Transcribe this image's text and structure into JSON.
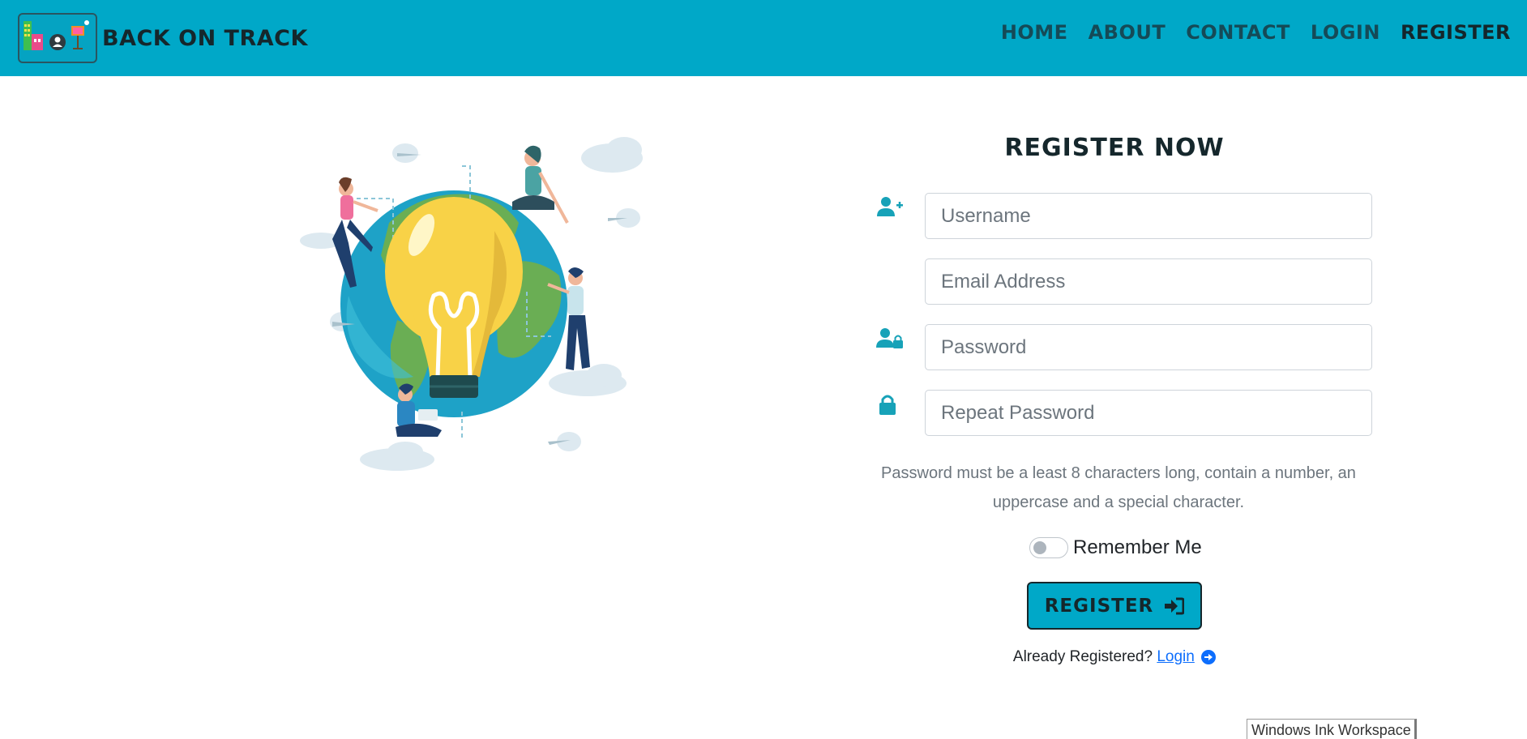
{
  "brand": {
    "name": "Back On Track"
  },
  "nav": {
    "items": [
      {
        "label": "Home"
      },
      {
        "label": "About"
      },
      {
        "label": "Contact"
      },
      {
        "label": "Login"
      },
      {
        "label": "Register"
      }
    ],
    "active": "Register"
  },
  "form": {
    "title": "Register Now",
    "fields": {
      "username": {
        "placeholder": "Username",
        "icon": "user-plus-icon"
      },
      "email": {
        "placeholder": "Email Address"
      },
      "password": {
        "placeholder": "Password",
        "icon": "user-lock-icon"
      },
      "repeat_password": {
        "placeholder": "Repeat Password",
        "icon": "lock-icon"
      }
    },
    "hint": "Password must be a least 8 characters long, contain a number, an uppercase and a special character.",
    "remember_label": "Remember Me",
    "remember_checked": false,
    "submit_label": "Register",
    "already_text": "Already Registered?",
    "login_link": "Login"
  },
  "overlay": {
    "ink_workspace": "Windows Ink Workspace"
  },
  "colors": {
    "accent": "#00a8c8",
    "dark": "#15272c",
    "link": "#0d6efd",
    "muted": "#6c757d"
  }
}
